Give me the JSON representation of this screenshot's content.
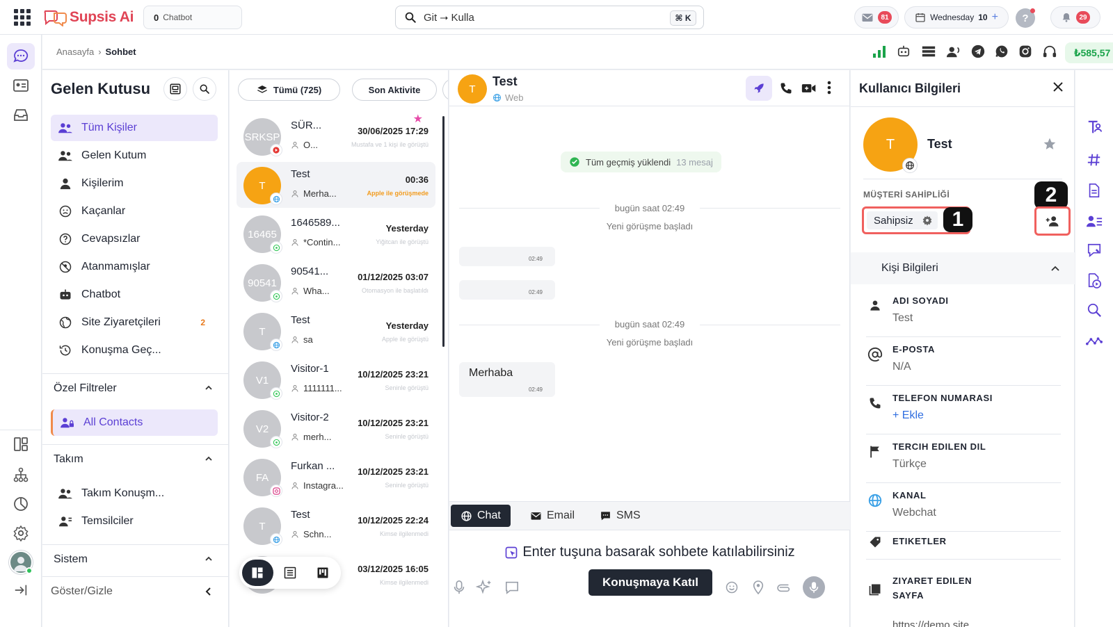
{
  "app": {
    "name": "Supsis Ai",
    "workspace_count": "0",
    "workspace_name": "Chatbot"
  },
  "search": {
    "value": "Git ⭢ Kulla",
    "shortcut": "⌘ K"
  },
  "top": {
    "mail_count": "81",
    "day": "Wednesday",
    "date": "10",
    "notif_count": "29",
    "help": "?"
  },
  "breadcrumb": {
    "home": "Anasayfa",
    "sep": "›",
    "current": "Sohbet"
  },
  "balance": "₺585,57",
  "inbox": {
    "title": "Gelen Kutusu",
    "items": [
      {
        "label": "Tüm Kişiler",
        "icon": "people-icon"
      },
      {
        "label": "Gelen Kutum",
        "icon": "people-icon"
      },
      {
        "label": "Kişilerim",
        "icon": "person-icon"
      },
      {
        "label": "Kaçanlar",
        "icon": "sad-face-icon"
      },
      {
        "label": "Cevapsızlar",
        "icon": "question-icon"
      },
      {
        "label": "Atanmamışlar",
        "icon": "blocked-icon"
      },
      {
        "label": "Chatbot",
        "icon": "robot-icon"
      },
      {
        "label": "Site Ziyaretçileri",
        "icon": "globe-icon",
        "count": "2"
      },
      {
        "label": "Konuşma Geç...",
        "icon": "history-icon"
      }
    ],
    "special_filters": {
      "title": "Özel Filtreler",
      "items": [
        {
          "label": "All Contacts"
        }
      ]
    },
    "team": {
      "title": "Takım",
      "items": [
        {
          "label": "Takım Konuşm..."
        },
        {
          "label": "Temsilciler"
        }
      ]
    },
    "system": {
      "title": "Sistem"
    },
    "toggle": "Göster/Gizle"
  },
  "conv_filters": {
    "all": "Tümü (725)",
    "sort": "Son Aktivite"
  },
  "conversations": [
    {
      "initials": "SRKSP",
      "name": "SÜR...",
      "preview": "O...",
      "time": "30/06/2025 17:29",
      "note": "Mustafa ve 1 kişi ile görüştü",
      "color": "#c8c9cd",
      "channel": "youtube"
    },
    {
      "initials": "T",
      "name": "Test",
      "preview": "Merha...",
      "time": "00:36",
      "note": "Apple ile görüşmede",
      "color": "#f6a313",
      "channel": "web"
    },
    {
      "initials": "16465",
      "name": "1646589...",
      "preview": "*Contin...",
      "time": "Yesterday",
      "note": "Yiğitcan ile görüştü",
      "color": "#c8c9cd",
      "channel": "whatsapp"
    },
    {
      "initials": "90541",
      "name": "90541...",
      "preview": "Wha...",
      "time": "01/12/2025 03:07",
      "note": "Otomasyon ile başlatıldı",
      "color": "#c8c9cd",
      "channel": "whatsapp"
    },
    {
      "initials": "T",
      "name": "Test",
      "preview": "sa",
      "time": "Yesterday",
      "note": "Apple ile görüştü",
      "color": "#c8c9cd",
      "channel": "web"
    },
    {
      "initials": "V1",
      "name": "Visitor-1",
      "preview": "1111111...",
      "time": "10/12/2025 23:21",
      "note": "Seninle görüştü",
      "color": "#c8c9cd",
      "channel": "whatsapp"
    },
    {
      "initials": "V2",
      "name": "Visitor-2",
      "preview": "merh...",
      "time": "10/12/2025 23:21",
      "note": "Seninle görüştü",
      "color": "#c8c9cd",
      "channel": "whatsapp"
    },
    {
      "initials": "FA",
      "name": "Furkan ...",
      "preview": "Instagra...",
      "time": "10/12/2025 23:21",
      "note": "Seninle görüştü",
      "color": "#c8c9cd",
      "channel": "instagram"
    },
    {
      "initials": "T",
      "name": "Test",
      "preview": "Schn...",
      "time": "10/12/2025 22:24",
      "note": "Kimse ilgilenmedi",
      "color": "#c8c9cd",
      "channel": "web"
    },
    {
      "initials": "",
      "name": "",
      "preview": "",
      "time": "03/12/2025 16:05",
      "note": "Kimse ilgilenmedi",
      "color": "#c8c9cd",
      "channel": ""
    }
  ],
  "chat": {
    "name": "Test",
    "avatar": "T",
    "channel": "Web",
    "loaded": "Tüm geçmiş yüklendi",
    "loaded_count": "13 mesaj",
    "sep1_time": "bugün saat 02:49",
    "sep1_text": "Yeni görüşme başladı",
    "sep2_time": "bugün saat 02:49",
    "sep2_text": "Yeni görüşme başladı",
    "msg_time": "02:49",
    "message": "Merhaba",
    "tabs": [
      "Chat",
      "Email",
      "SMS"
    ],
    "join_hint": "Enter tuşuna basarak sohbete katılabilirsiniz",
    "join_button": "Konuşmaya Katıl"
  },
  "user_info": {
    "title": "Kullanıcı Bilgileri",
    "name": "Test",
    "avatar": "T",
    "owner_label": "MÜŞTERİ SAHİPLİĞİ",
    "owner_value": "Sahipsiz",
    "marker1": "1",
    "marker2": "2",
    "section": "Kişi Bilgileri",
    "fields": [
      {
        "label": "ADI SOYADI",
        "value": "Test"
      },
      {
        "label": "E-POSTA",
        "value": "N/A"
      },
      {
        "label": "TELEFON NUMARASI",
        "value": "+ Ekle"
      },
      {
        "label": "TERCIH EDILEN DIL",
        "value": "Türkçe"
      },
      {
        "label": "KANAL",
        "value": "Webchat"
      },
      {
        "label": "ETIKETLER",
        "value": ""
      },
      {
        "label": "ZIYARET EDILEN SAYFA",
        "value": "https://demo.site"
      }
    ]
  },
  "colors": {
    "accent": "#5b3fd4",
    "brand": "#e04455",
    "avatar_orange": "#f6a313",
    "highlight": "#f0605e",
    "balance_green": "#1aa34a"
  }
}
